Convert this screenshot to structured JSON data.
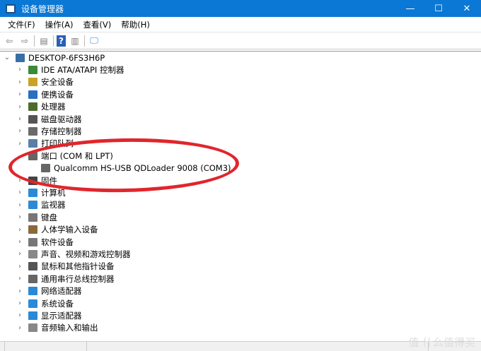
{
  "window": {
    "title": "设备管理器",
    "minimize": "—",
    "maximize": "☐",
    "close": "✕"
  },
  "menu": [
    "文件(F)",
    "操作(A)",
    "查看(V)",
    "帮助(H)"
  ],
  "tree": {
    "root": "DESKTOP-6FS3H6P",
    "items": [
      {
        "label": "IDE ATA/ATAPI 控制器",
        "color": "#3a8a3a"
      },
      {
        "label": "安全设备",
        "color": "#c9a227"
      },
      {
        "label": "便携设备",
        "color": "#2a6fc0"
      },
      {
        "label": "处理器",
        "color": "#4d6b2f"
      },
      {
        "label": "磁盘驱动器",
        "color": "#555555"
      },
      {
        "label": "存储控制器",
        "color": "#6a6a6a"
      },
      {
        "label": "打印队列",
        "color": "#5a7fa8"
      },
      {
        "label": "端口 (COM 和 LPT)",
        "color": "#666666",
        "expanded": true
      },
      {
        "label": "Qualcomm HS-USB QDLoader 9008 (COM3)",
        "color": "#666666",
        "child": true
      },
      {
        "label": "固件",
        "color": "#444444"
      },
      {
        "label": "计算机",
        "color": "#2a8ad8"
      },
      {
        "label": "监视器",
        "color": "#2a8ad8"
      },
      {
        "label": "键盘",
        "color": "#777777"
      },
      {
        "label": "人体学输入设备",
        "color": "#8a6a3a"
      },
      {
        "label": "软件设备",
        "color": "#777777"
      },
      {
        "label": "声音、视频和游戏控制器",
        "color": "#888888"
      },
      {
        "label": "鼠标和其他指针设备",
        "color": "#555555"
      },
      {
        "label": "通用串行总线控制器",
        "color": "#666666"
      },
      {
        "label": "网络适配器",
        "color": "#2a8ad8"
      },
      {
        "label": "系统设备",
        "color": "#2a8ad8"
      },
      {
        "label": "显示适配器",
        "color": "#2a8ad8"
      },
      {
        "label": "音频输入和输出",
        "color": "#888888"
      }
    ]
  },
  "watermark": "值 什么值得买",
  "highlight_color": "#e0262c"
}
